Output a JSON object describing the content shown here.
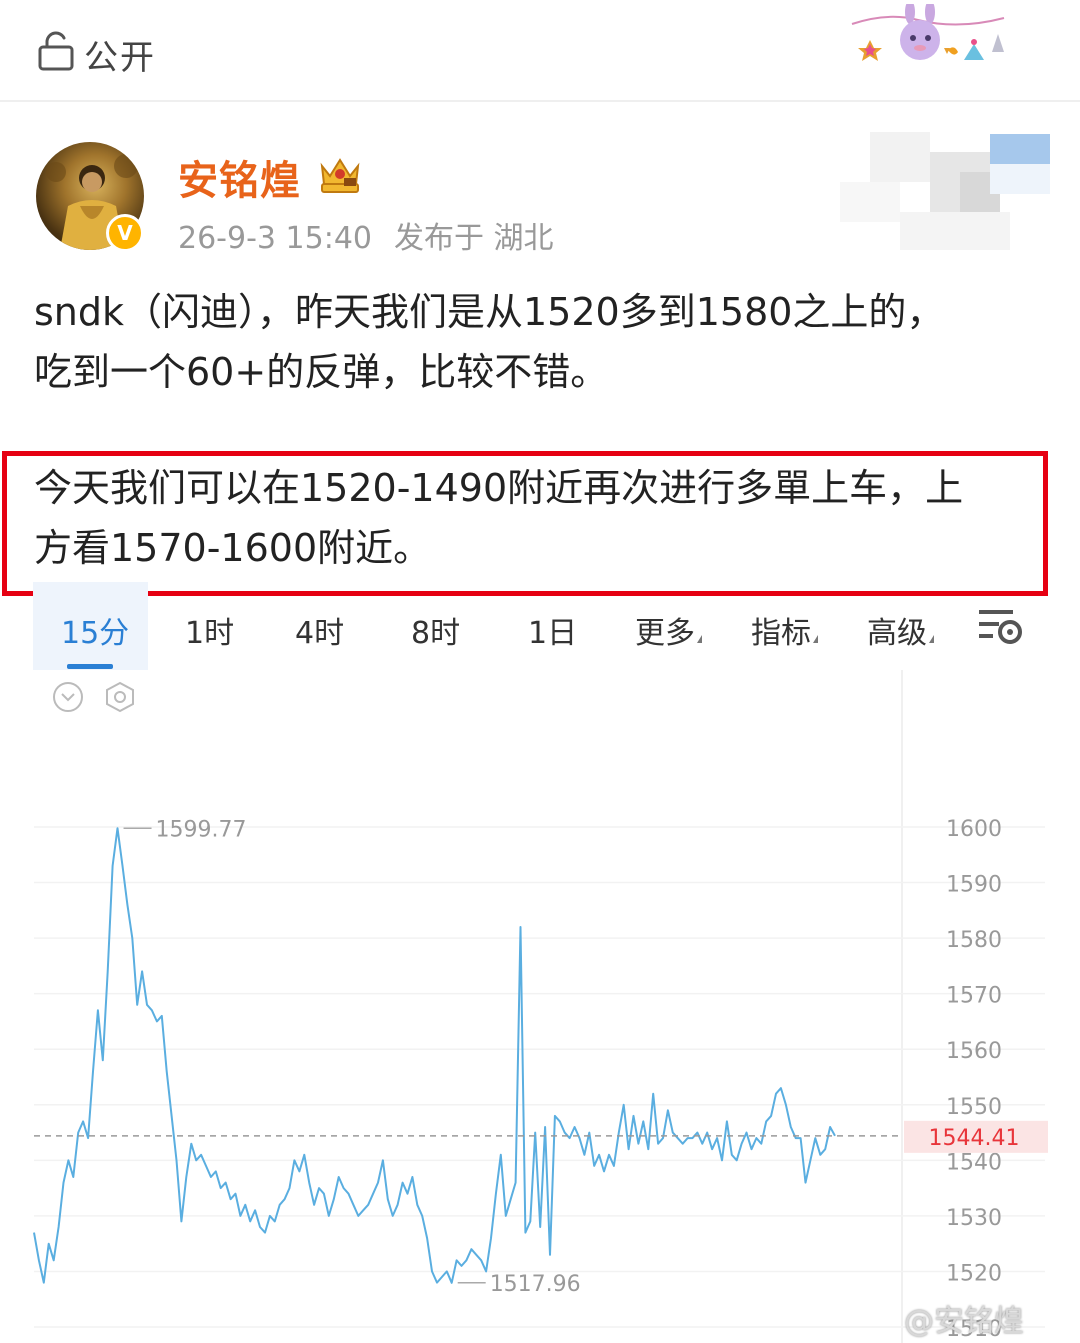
{
  "topbar": {
    "visibility_label": "公开",
    "lock_icon": "lock-icon",
    "decoration_icon": "party-bunny-icon"
  },
  "post_header": {
    "username": "安铭煌",
    "username_color": "#e8631a",
    "badge_icon": "crown-vip-icon",
    "verified_icon": "verified-v-icon",
    "timestamp": "26-9-3 15:40",
    "location": "发布于 湖北"
  },
  "post_body": {
    "line1": "sndk（闪迪），昨天我们是从1520多到1580之上的，",
    "line2": "吃到一个60+的反弹，比较不错。",
    "highlight_line1": "今天我们可以在1520-1490附近再次进行多單上车，上",
    "highlight_line2": "方看1570-1600附近。",
    "highlight_color": "#e60012"
  },
  "chart_tabs": {
    "items": [
      "15分",
      "1时",
      "4时",
      "8时",
      "1日",
      "更多",
      "指标",
      "高级"
    ],
    "active": "15分",
    "accent_color": "#2a7fd4",
    "settings_icon": "chart-settings-icon"
  },
  "chart_data": {
    "type": "line",
    "line_color": "#5aaee0",
    "y_ticks": [
      "1600",
      "1590",
      "1580",
      "1570",
      "1560",
      "1550",
      "1540",
      "1530",
      "1520",
      "1510"
    ],
    "ylim": [
      1510,
      1600
    ],
    "current_price": "1544.41",
    "current_price_color": "#e8353a",
    "max_label": "1599.77",
    "min_label": "1517.96",
    "values": [
      1527,
      1522,
      1518,
      1525,
      1522,
      1528,
      1536,
      1540,
      1537,
      1545,
      1547,
      1544,
      1556,
      1567,
      1558,
      1574,
      1593,
      1599.77,
      1593,
      1586,
      1580,
      1568,
      1574,
      1568,
      1567,
      1565,
      1566,
      1556,
      1548,
      1540,
      1529,
      1537,
      1543,
      1540,
      1541,
      1539,
      1537,
      1538,
      1535,
      1536,
      1533,
      1534,
      1530,
      1532,
      1529,
      1531,
      1528,
      1527,
      1530,
      1529,
      1532,
      1533,
      1535,
      1540,
      1538,
      1541,
      1536,
      1532,
      1535,
      1534,
      1530,
      1533,
      1537,
      1535,
      1534,
      1532,
      1530,
      1531,
      1532,
      1534,
      1536,
      1540,
      1533,
      1530,
      1532,
      1536,
      1534,
      1537,
      1532,
      1530,
      1526,
      1520,
      1518,
      1519,
      1520,
      1517.96,
      1522,
      1521,
      1522,
      1524,
      1523,
      1522,
      1520,
      1526,
      1534,
      1541,
      1530,
      1533,
      1536,
      1582,
      1527,
      1529,
      1545,
      1528,
      1546,
      1523,
      1548,
      1547,
      1545,
      1544,
      1546,
      1544,
      1541,
      1545,
      1539,
      1541,
      1538,
      1541,
      1539,
      1545,
      1550,
      1542,
      1548,
      1543,
      1547,
      1542,
      1552,
      1543,
      1544,
      1549,
      1545,
      1544,
      1543,
      1544,
      1544,
      1545,
      1543,
      1545,
      1542,
      1544,
      1540,
      1547,
      1541,
      1540,
      1543,
      1545,
      1542,
      1544,
      1543,
      1547,
      1548,
      1552,
      1553,
      1550,
      1546,
      1544,
      1544,
      1536,
      1540,
      1544,
      1541,
      1542,
      1546,
      1544.41
    ],
    "grid": true,
    "reference_line": "dashed"
  },
  "watermark": {
    "text": "@安铭煌"
  }
}
